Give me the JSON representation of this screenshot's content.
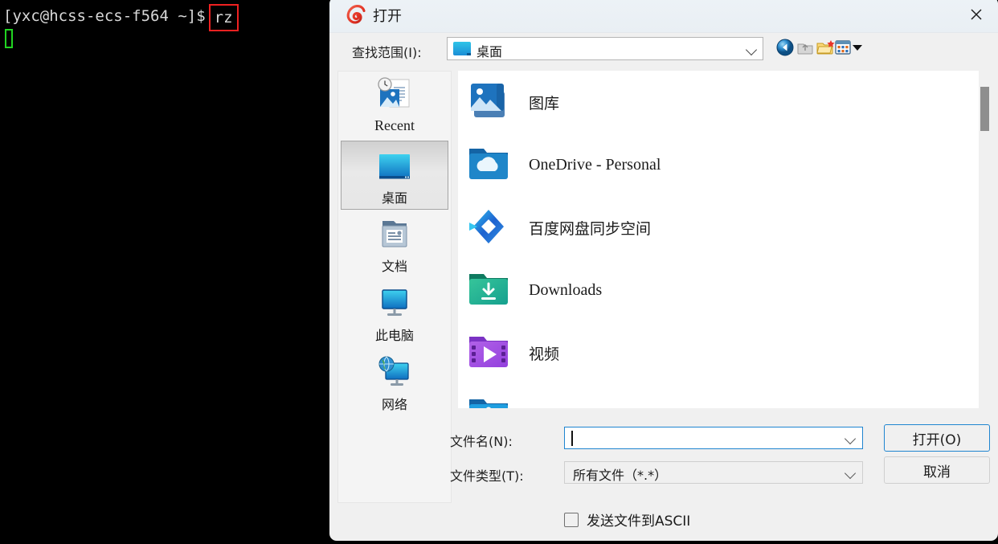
{
  "terminal": {
    "prompt": "[yxc@hcss-ecs-f564 ~]$",
    "command": "rz",
    "highlight_color": "#ef2121",
    "cursor_color": "#21d421",
    "background": "#000000",
    "foreground": "#d8d8d8"
  },
  "dialog": {
    "title": "打开",
    "title_icon": "xshell-spiral-icon",
    "close_label": "✕",
    "lookin": {
      "label": "查找范围(I):",
      "value": "桌面",
      "icon": "desktop-icon"
    },
    "toolbar": [
      {
        "name": "back-icon",
        "title": "返回"
      },
      {
        "name": "up-folder-icon",
        "title": "向上一级"
      },
      {
        "name": "new-folder-icon",
        "title": "新建文件夹"
      },
      {
        "name": "view-mode-icon",
        "title": "查看"
      }
    ],
    "sidebar": {
      "items": [
        {
          "label": "Recent",
          "icon": "recent-icon",
          "lang": "en",
          "selected": false
        },
        {
          "label": "桌面",
          "icon": "desktop-icon",
          "lang": "cjk",
          "selected": true
        },
        {
          "label": "文档",
          "icon": "documents-icon",
          "lang": "cjk",
          "selected": false
        },
        {
          "label": "此电脑",
          "icon": "this-pc-icon",
          "lang": "cjk",
          "selected": false
        },
        {
          "label": "网络",
          "icon": "network-icon",
          "lang": "cjk",
          "selected": false
        }
      ]
    },
    "files": [
      {
        "name": "图库",
        "icon": "gallery-icon",
        "lang": "cjk"
      },
      {
        "name": "OneDrive - Personal",
        "icon": "onedrive-folder-icon",
        "lang": "en"
      },
      {
        "name": "百度网盘同步空间",
        "icon": "baidu-netdisk-icon",
        "lang": "cjk"
      },
      {
        "name": "Downloads",
        "icon": "downloads-folder-icon",
        "lang": "en"
      },
      {
        "name": "视频",
        "icon": "videos-folder-icon",
        "lang": "cjk"
      },
      {
        "name": "",
        "icon": "blue-folder-icon",
        "lang": "cjk"
      }
    ],
    "form": {
      "filename_label": "文件名(N):",
      "filename_value": "",
      "filetype_label": "文件类型(T):",
      "filetype_value": "所有文件（*.*）",
      "open_button": "打开(O)",
      "cancel_button": "取消",
      "ascii_checkbox_label": "发送文件到ASCII",
      "ascii_checked": false
    },
    "colors": {
      "titlebar": "#eaf0f4",
      "body": "#f0f0f0",
      "accent": "#1f85d0",
      "list_bg": "#ffffff"
    }
  }
}
